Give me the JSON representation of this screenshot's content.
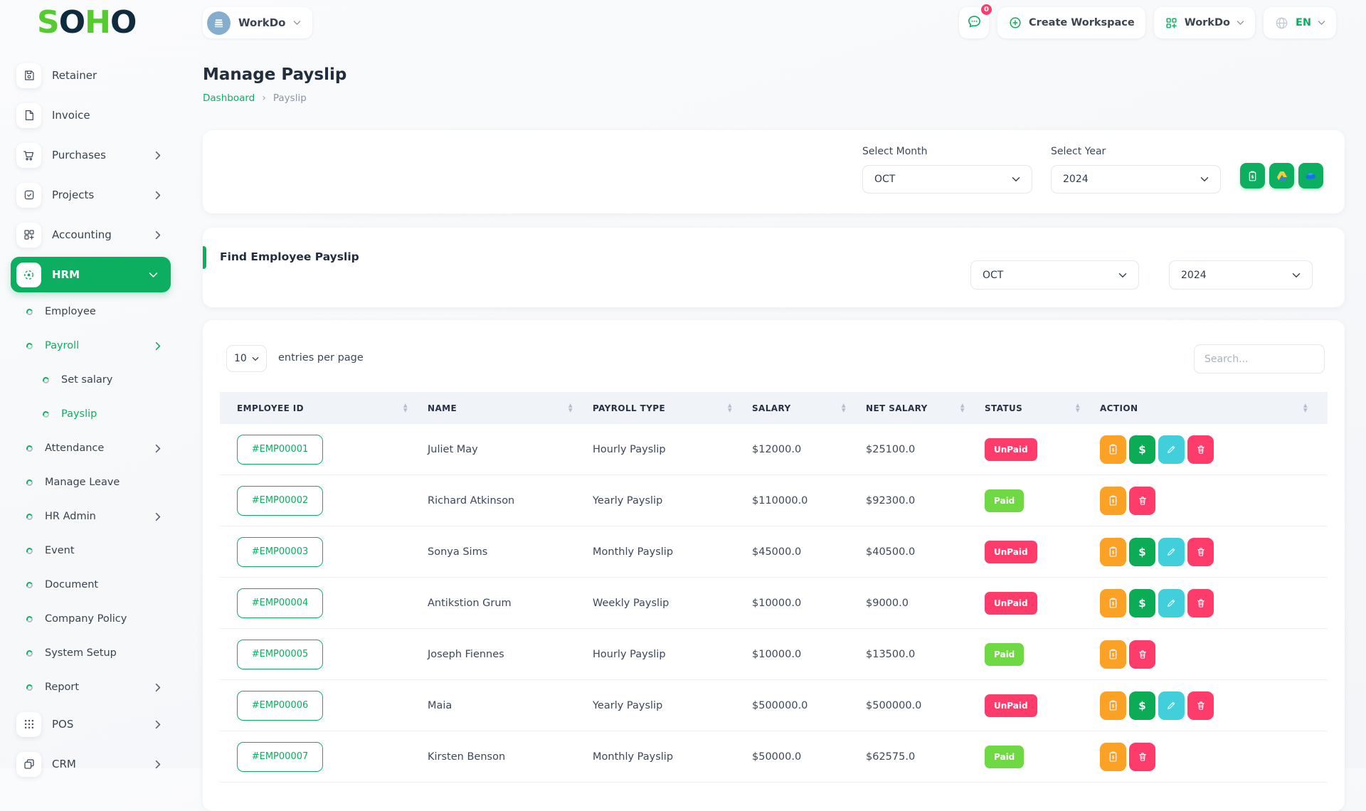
{
  "colors": {
    "primary": "#0CAF60",
    "paid_badge": "#6FD943",
    "unpaid_badge": "#FD3C6B",
    "action_orange": "#FBA226",
    "action_green": "#0CAB55",
    "action_cyan": "#41D0DB",
    "action_pink": "#FD3C6B"
  },
  "logo": {
    "s": "S",
    "o1": "O",
    "h": "H",
    "o2": "O"
  },
  "sidebar": {
    "items": [
      {
        "label": "Retainer",
        "slug": "retainer",
        "icon": "floppy-icon",
        "style": "box"
      },
      {
        "label": "Invoice",
        "slug": "invoice",
        "icon": "file-icon",
        "style": "box"
      },
      {
        "label": "Purchases",
        "slug": "purchases",
        "icon": "cart-icon",
        "style": "box",
        "chevron": "right"
      },
      {
        "label": "Projects",
        "slug": "projects",
        "icon": "check-square-icon",
        "style": "box",
        "chevron": "right"
      },
      {
        "label": "Accounting",
        "slug": "accounting",
        "icon": "grid-plus-icon",
        "style": "box",
        "chevron": "right"
      },
      {
        "label": "HRM",
        "slug": "hrm",
        "icon": "hrm-icon",
        "style": "box",
        "chevron": "down",
        "active": true
      },
      {
        "label": "Employee",
        "slug": "employee",
        "style": "bullet"
      },
      {
        "label": "Payroll",
        "slug": "payroll",
        "style": "bullet",
        "chevron": "right",
        "green": true
      },
      {
        "label": "Set salary",
        "slug": "set-salary",
        "style": "sub"
      },
      {
        "label": "Payslip",
        "slug": "payslip",
        "style": "sub",
        "green": true
      },
      {
        "label": "Attendance",
        "slug": "attendance",
        "style": "bullet",
        "chevron": "right"
      },
      {
        "label": "Manage Leave",
        "slug": "manage-leave",
        "style": "bullet"
      },
      {
        "label": "HR Admin",
        "slug": "hr-admin",
        "style": "bullet",
        "chevron": "right"
      },
      {
        "label": "Event",
        "slug": "event",
        "style": "bullet"
      },
      {
        "label": "Document",
        "slug": "document",
        "style": "bullet"
      },
      {
        "label": "Company Policy",
        "slug": "company-policy",
        "style": "bullet"
      },
      {
        "label": "System Setup",
        "slug": "system-setup",
        "style": "bullet"
      },
      {
        "label": "Report",
        "slug": "report",
        "style": "bullet",
        "chevron": "right"
      },
      {
        "label": "POS",
        "slug": "pos",
        "icon": "grid-dots-icon",
        "style": "box",
        "chevron": "right"
      },
      {
        "label": "CRM",
        "slug": "crm",
        "icon": "crm-icon",
        "style": "box",
        "chevron": "right"
      }
    ]
  },
  "topbar": {
    "workspace_chip_label": "WorkDo",
    "messages_count": "0",
    "create_workspace_label": "Create Workspace",
    "workdo_menu_label": "WorkDo",
    "language_label": "EN"
  },
  "page": {
    "title": "Manage Payslip",
    "breadcrumb_home": "Dashboard",
    "breadcrumb_current": "Payslip"
  },
  "filter_card": {
    "month_label": "Select Month",
    "month_value": "OCT",
    "year_label": "Select Year",
    "year_value": "2024",
    "buttons": [
      "payslip-export",
      "google-drive",
      "one-drive"
    ]
  },
  "find_card": {
    "title": "Find Employee Payslip",
    "month_value": "OCT",
    "year_value": "2024"
  },
  "table": {
    "entries_value": "10",
    "entries_label": "entries per page",
    "search_placeholder": "Search...",
    "columns": [
      "EMPLOYEE ID",
      "NAME",
      "PAYROLL TYPE",
      "SALARY",
      "NET SALARY",
      "STATUS",
      "ACTION"
    ],
    "rows": [
      {
        "id": "#EMP00001",
        "name": "Juliet May",
        "payroll_type": "Hourly Payslip",
        "salary": "$12000.0",
        "net_salary": "$25100.0",
        "status": "UnPaid",
        "actions": [
          "payslip",
          "pay",
          "edit",
          "delete"
        ]
      },
      {
        "id": "#EMP00002",
        "name": "Richard Atkinson",
        "payroll_type": "Yearly Payslip",
        "salary": "$110000.0",
        "net_salary": "$92300.0",
        "status": "Paid",
        "actions": [
          "payslip",
          "delete"
        ]
      },
      {
        "id": "#EMP00003",
        "name": "Sonya Sims",
        "payroll_type": "Monthly Payslip",
        "salary": "$45000.0",
        "net_salary": "$40500.0",
        "status": "UnPaid",
        "actions": [
          "payslip",
          "pay",
          "edit",
          "delete"
        ]
      },
      {
        "id": "#EMP00004",
        "name": "Antikstion Grum",
        "payroll_type": "Weekly Payslip",
        "salary": "$10000.0",
        "net_salary": "$9000.0",
        "status": "UnPaid",
        "actions": [
          "payslip",
          "pay",
          "edit",
          "delete"
        ]
      },
      {
        "id": "#EMP00005",
        "name": "Joseph Fiennes",
        "payroll_type": "Hourly Payslip",
        "salary": "$10000.0",
        "net_salary": "$13500.0",
        "status": "Paid",
        "actions": [
          "payslip",
          "delete"
        ]
      },
      {
        "id": "#EMP00006",
        "name": "Maia",
        "payroll_type": "Yearly Payslip",
        "salary": "$500000.0",
        "net_salary": "$500000.0",
        "status": "UnPaid",
        "actions": [
          "payslip",
          "pay",
          "edit",
          "delete"
        ]
      },
      {
        "id": "#EMP00007",
        "name": "Kirsten Benson",
        "payroll_type": "Monthly Payslip",
        "salary": "$50000.0",
        "net_salary": "$62575.0",
        "status": "Paid",
        "actions": [
          "payslip",
          "delete"
        ]
      }
    ]
  }
}
